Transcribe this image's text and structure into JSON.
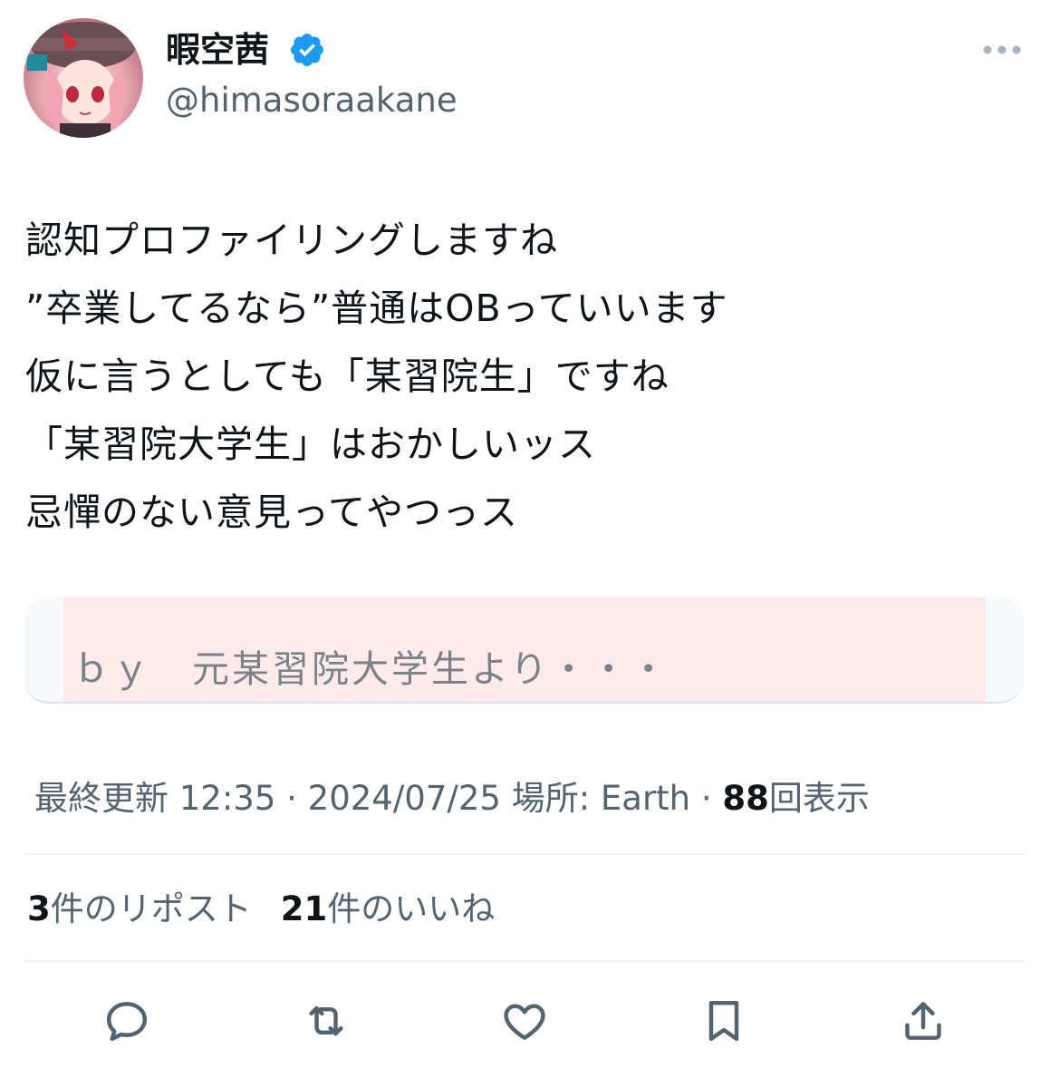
{
  "author": {
    "display_name": "暇空茜",
    "handle": "@himasoraakane",
    "verified_icon": "verified-badge-icon",
    "avatar_icon": "avatar"
  },
  "tweet": {
    "lines": [
      "認知プロファイリングしますね",
      "”卒業してるなら”普通はOBっていいます",
      "仮に言うとしても「某習院生」ですね",
      "「某習院大学生」はおかしいッス",
      "忌憚のない意見ってやつっス"
    ]
  },
  "quote": {
    "text": "ｂｙ　元某習院大学生より・・・"
  },
  "meta": {
    "prefix": "最終更新 12:35 · 2024/07/25  場所: Earth · ",
    "views_count": "88",
    "views_label": "回表示"
  },
  "stats": {
    "reposts_count": "3",
    "reposts_label": "件のリポスト",
    "likes_count": "21",
    "likes_label": "件のいいね"
  },
  "actions": [
    "reply-icon",
    "repost-icon",
    "like-icon",
    "bookmark-icon",
    "share-icon"
  ],
  "colors": {
    "accent": "#1d9bf0",
    "secondary_text": "#536471",
    "primary_text": "#0f1419"
  }
}
